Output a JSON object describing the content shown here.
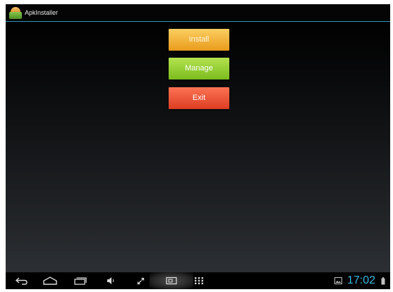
{
  "titlebar": {
    "app_title": "ApkInstaller",
    "app_icon": "android-package-icon"
  },
  "menu": {
    "install_label": "Install",
    "manage_label": "Manage",
    "exit_label": "Exit"
  },
  "navbar": {
    "icons": [
      "back-icon",
      "home-icon",
      "recent-apps-icon",
      "volume-down-icon",
      "volume-up-icon",
      "screenshot-icon",
      "app-drawer-icon",
      "gallery-icon",
      "battery-icon"
    ],
    "clock": "17:02"
  },
  "colors": {
    "accent_line": "#2f93b4",
    "install_button": "#f6b53e",
    "manage_button": "#9fd53b",
    "exit_button": "#f0573a",
    "clock_text": "#3fb5de"
  }
}
